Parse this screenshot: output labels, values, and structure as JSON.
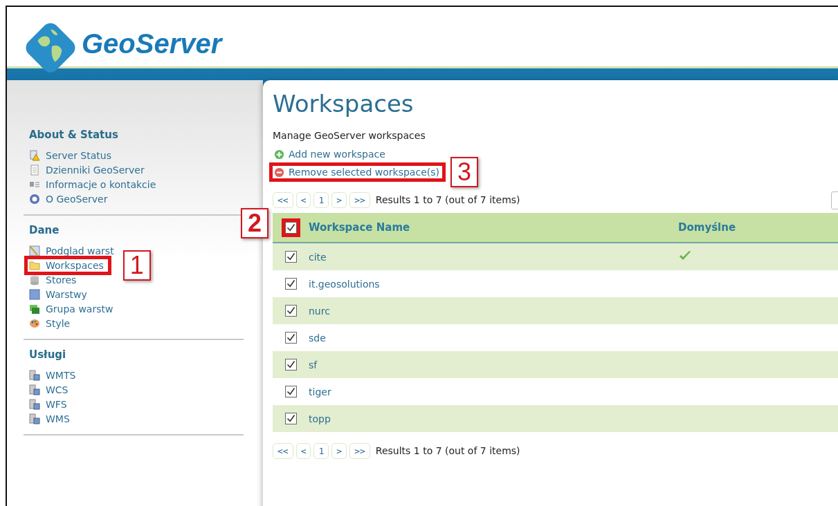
{
  "logo": {
    "text": "GeoServer"
  },
  "sidebar": {
    "sections": [
      {
        "title": "About & Status",
        "items": [
          {
            "label": "Server Status"
          },
          {
            "label": "Dzienniki GeoServer"
          },
          {
            "label": "Informacje o kontakcie"
          },
          {
            "label": "O GeoServer"
          }
        ]
      },
      {
        "title": "Dane",
        "items": [
          {
            "label": "Podglad warst"
          },
          {
            "label": "Workspaces",
            "callout": "1"
          },
          {
            "label": "Stores"
          },
          {
            "label": "Warstwy"
          },
          {
            "label": "Grupa warstw"
          },
          {
            "label": "Style"
          }
        ]
      },
      {
        "title": "Usługi",
        "items": [
          {
            "label": "WMTS"
          },
          {
            "label": "WCS"
          },
          {
            "label": "WFS"
          },
          {
            "label": "WMS"
          }
        ]
      }
    ]
  },
  "page": {
    "title": "Workspaces",
    "description": "Manage GeoServer workspaces",
    "actions": [
      {
        "label": "Add new workspace",
        "kind": "add"
      },
      {
        "label": "Remove selected workspace(s)",
        "kind": "remove",
        "callout": "3"
      }
    ],
    "pager_top": {
      "buttons": [
        "<<",
        "<",
        "1",
        ">",
        ">>"
      ],
      "summary": "Results 1 to 7 (out of 7 items)"
    },
    "table": {
      "select_all": {
        "checked": true,
        "callout": "2"
      },
      "columns": [
        "Workspace Name",
        "Domyślne"
      ],
      "rows": [
        {
          "name": "cite",
          "checked": true,
          "default": true
        },
        {
          "name": "it.geosolutions",
          "checked": true,
          "default": false
        },
        {
          "name": "nurc",
          "checked": true,
          "default": false
        },
        {
          "name": "sde",
          "checked": true,
          "default": false
        },
        {
          "name": "sf",
          "checked": true,
          "default": false
        },
        {
          "name": "tiger",
          "checked": true,
          "default": false
        },
        {
          "name": "topp",
          "checked": true,
          "default": false
        }
      ]
    },
    "pager_bottom": {
      "buttons": [
        "<<",
        "<",
        "1",
        ">",
        ">>"
      ],
      "summary": "Results 1 to 7 (out of 7 items)"
    }
  }
}
